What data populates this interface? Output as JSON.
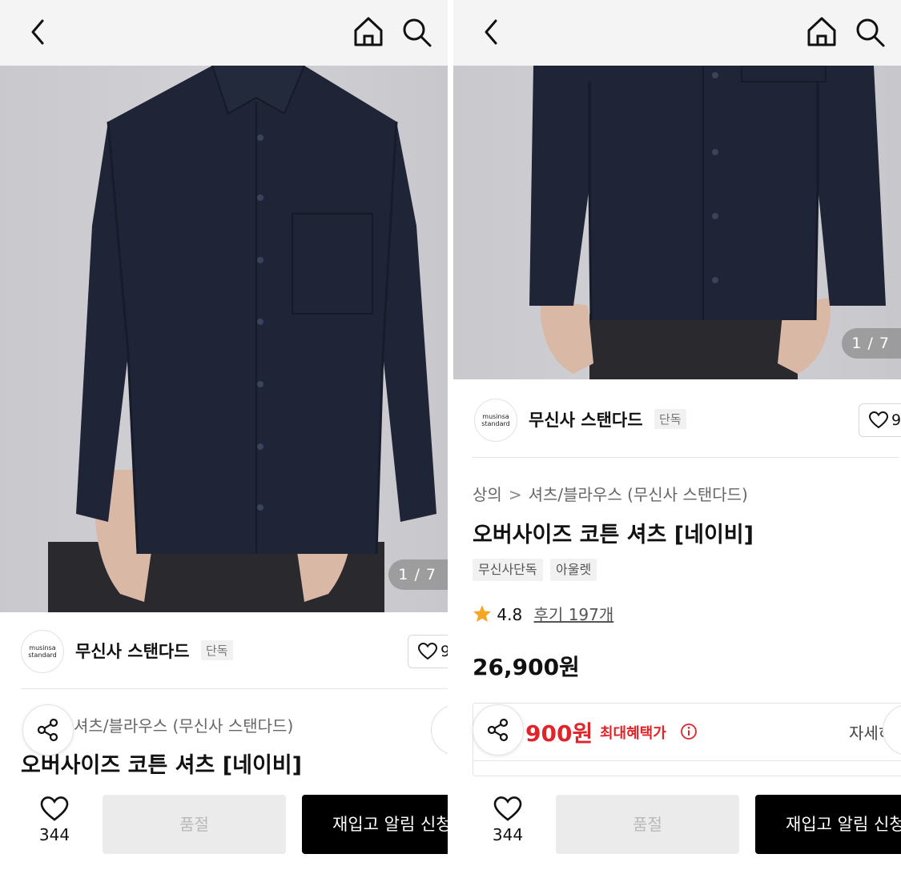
{
  "colors": {
    "accent_red": "#e0252a",
    "topbar_bg": "#f4f4f4",
    "shirt_navy": "#1f2536",
    "button_black": "#000000"
  },
  "icons": {
    "back": "chevron-left-icon",
    "home": "home-icon",
    "search": "search-icon",
    "share": "share-icon",
    "heart": "heart-icon",
    "star": "star-icon",
    "info": "info-icon"
  },
  "left": {
    "image_counter": "1 / 7",
    "brand": {
      "logo_line1": "musinsa",
      "logo_line2": "standard",
      "name": "무신사 스탠다드",
      "tag": "단독",
      "like_partial": "9"
    },
    "breadcrumb_partial": "셔츠/블라우스 (무신사 스탠다드)",
    "title": "오버사이즈 코튼 셔츠 [네이비]",
    "bottom": {
      "like_count": "344",
      "soldout_label": "품절",
      "restock_label": "재입고 알림 신청"
    }
  },
  "right": {
    "image_counter": "1 / 7",
    "brand": {
      "logo_line1": "musinsa",
      "logo_line2": "standard",
      "name": "무신사 스탠다드",
      "tag": "단독",
      "like_partial": "9"
    },
    "breadcrumb": {
      "category": "상의",
      "separator": ">",
      "subcategory": "셔츠/블라우스 (무신사 스탠다드)"
    },
    "title": "오버사이즈 코튼 셔츠 [네이비]",
    "tags": [
      "무신사단독",
      "아울렛"
    ],
    "rating": {
      "score": "4.8",
      "reviews": "후기 197개"
    },
    "price": "26,900원",
    "benefit": {
      "price_partial": "900원",
      "label": "최대혜택가",
      "detail_partial": "자세히"
    },
    "bottom": {
      "like_count": "344",
      "soldout_label": "품절",
      "restock_label": "재입고 알림 신청"
    }
  }
}
